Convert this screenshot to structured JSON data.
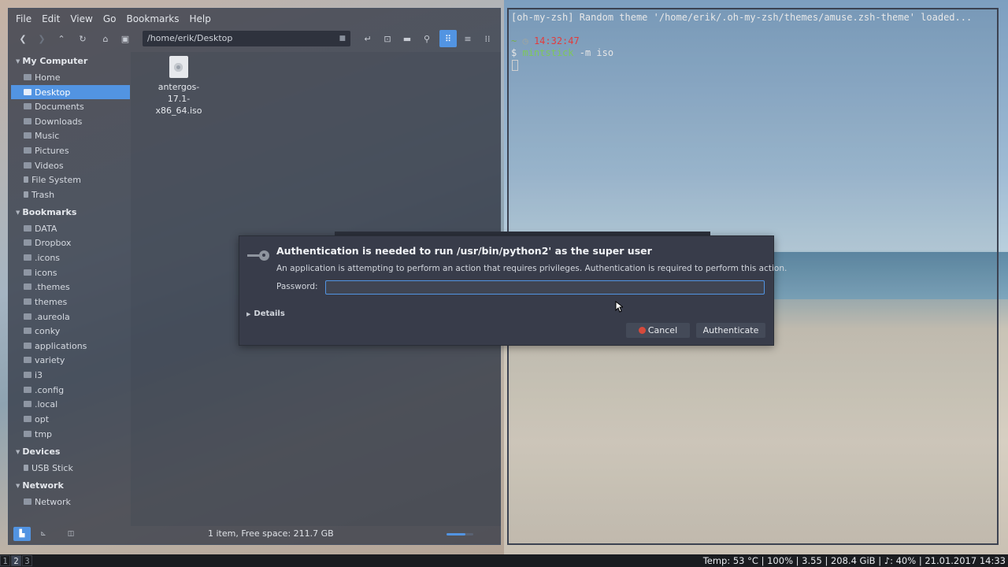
{
  "file_manager": {
    "menu": [
      "File",
      "Edit",
      "View",
      "Go",
      "Bookmarks",
      "Help"
    ],
    "path": "/home/erik/Desktop",
    "sidebar": {
      "sections": [
        {
          "title": "My Computer",
          "items": [
            "Home",
            "Desktop",
            "Documents",
            "Downloads",
            "Music",
            "Pictures",
            "Videos",
            "File System",
            "Trash"
          ]
        },
        {
          "title": "Bookmarks",
          "items": [
            "DATA",
            "Dropbox",
            ".icons",
            "icons",
            ".themes",
            "themes",
            ".aureola",
            "conky",
            "applications",
            "variety",
            "i3",
            ".config",
            ".local",
            "opt",
            "tmp"
          ]
        },
        {
          "title": "Devices",
          "items": [
            "USB Stick"
          ]
        },
        {
          "title": "Network",
          "items": [
            "Network"
          ]
        }
      ],
      "selected": "Desktop"
    },
    "files": [
      {
        "name_line1": "antergos-17.1-",
        "name_line2": "x86_64.iso",
        "icon": "disc-image-icon"
      }
    ],
    "status": "1 item, Free space: 211.7 GB",
    "zoom_level": 0.7
  },
  "terminal": {
    "title_line": "[oh-my-zsh] Random theme '/home/erik/.oh-my-zsh/themes/amuse.zsh-theme' loaded...",
    "prompt_dir": "~",
    "prompt_clock_icon": "◷",
    "prompt_time": "14:32:47",
    "prompt_symbol": "$",
    "command": "mintstick",
    "command_args": " -m iso"
  },
  "auth_dialog": {
    "title": "Authentication is needed to run /usr/bin/python2' as the super user",
    "message": "An application is attempting to perform an action that requires privileges. Authentication is required to perform this action.",
    "password_label": "Password:",
    "password_value": "",
    "details_label": "Details",
    "cancel_label": "Cancel",
    "authenticate_label": "Authenticate"
  },
  "bottom_bar": {
    "workspaces": [
      "1",
      "2",
      "3"
    ],
    "active_workspace": "2",
    "status": "Temp: 53 °C | 100% | 3.55 | 208.4 GiB | ♪: 40% | 21.01.2017 14:33"
  },
  "colors": {
    "accent": "#5294e2",
    "dialog_bg": "#383c4a",
    "cancel_red": "#d64a3c",
    "term_green": "#78b04a",
    "term_red": "#e23c3c"
  }
}
